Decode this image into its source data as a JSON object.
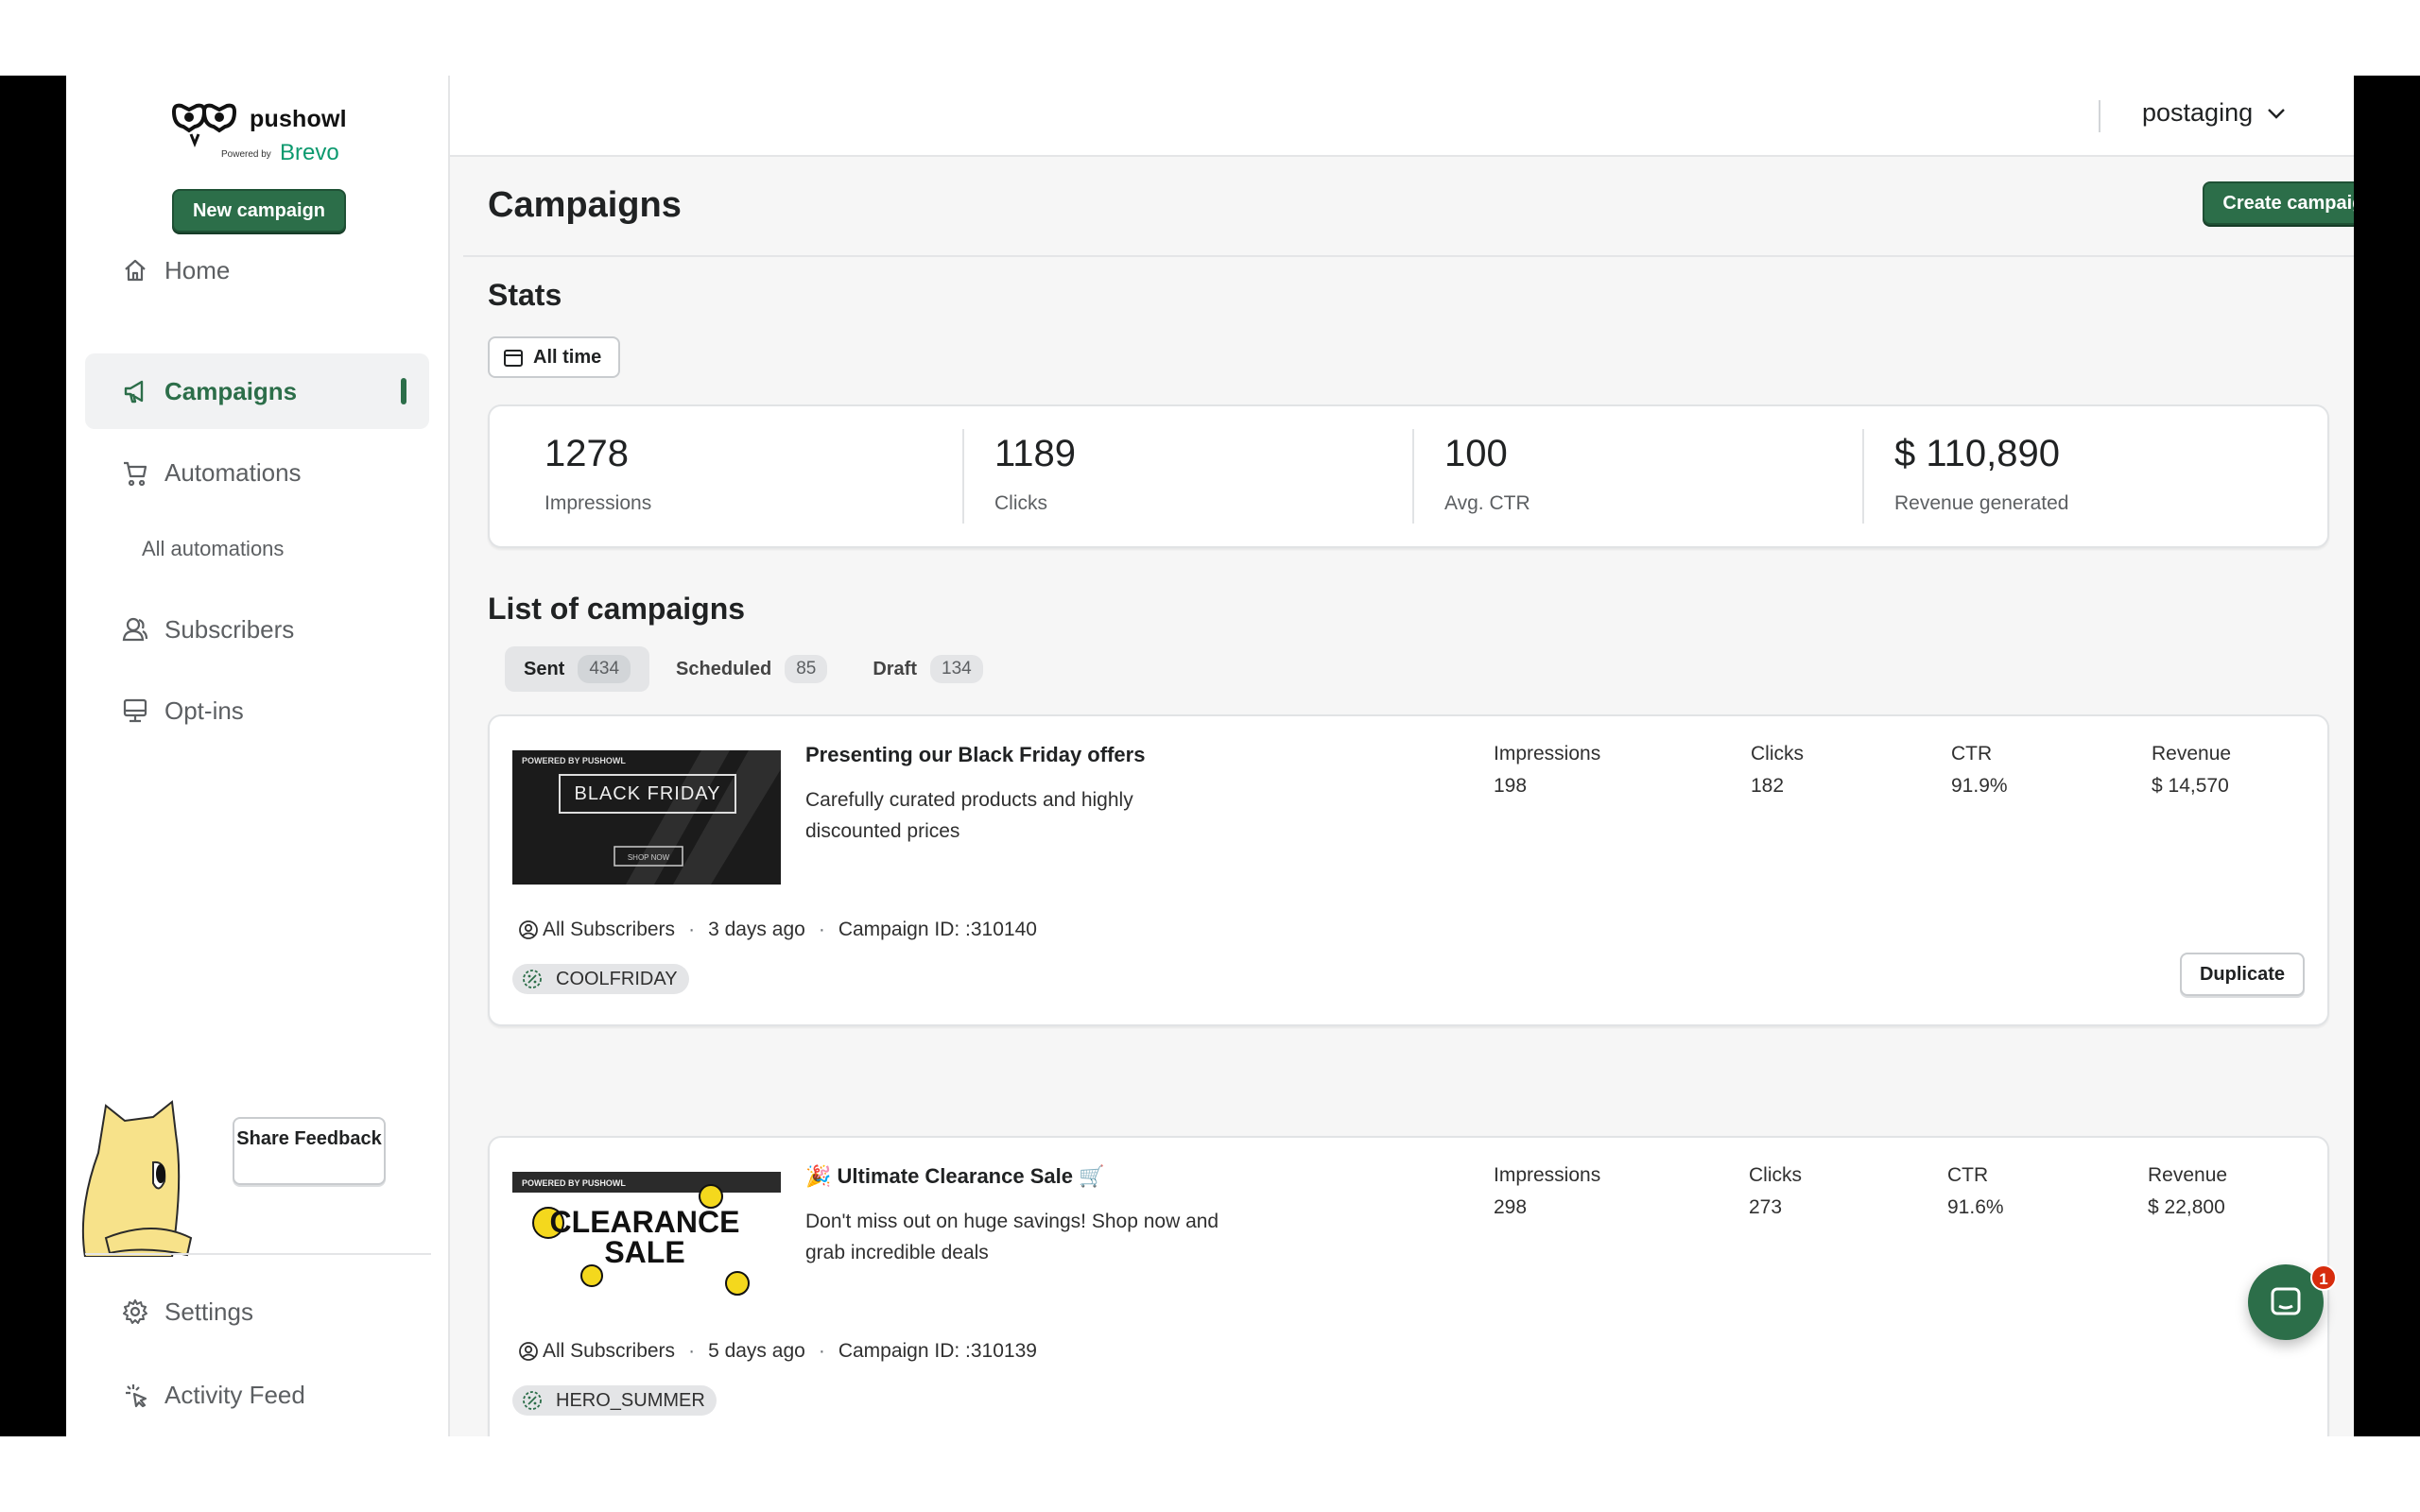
{
  "brand": {
    "name": "pushowl",
    "powered_by": "Powered by",
    "partner": "Brevo"
  },
  "sidebar": {
    "new_campaign_label": "New campaign",
    "items": [
      {
        "label": "Home",
        "icon": "home-icon"
      },
      {
        "label": "Campaigns",
        "icon": "megaphone-icon",
        "active": true
      },
      {
        "label": "Automations",
        "icon": "cart-icon"
      },
      {
        "label": "All automations",
        "sub": true
      },
      {
        "label": "Subscribers",
        "icon": "users-icon"
      },
      {
        "label": "Opt-ins",
        "icon": "monitor-icon"
      }
    ],
    "share_feedback": "Share Feedback",
    "bottom_items": [
      {
        "label": "Settings",
        "icon": "gear-icon"
      },
      {
        "label": "Activity Feed",
        "icon": "sparkle-icon"
      }
    ]
  },
  "topbar": {
    "store_name": "postaging"
  },
  "page": {
    "title": "Campaigns",
    "create_label": "Create campaign",
    "stats_title": "Stats",
    "time_filter": "All time",
    "stats": [
      {
        "value": "1278",
        "label": "Impressions"
      },
      {
        "value": "1189",
        "label": "Clicks"
      },
      {
        "value": "100",
        "label": "Avg. CTR"
      },
      {
        "value": "$ 110,890",
        "label": "Revenue generated"
      }
    ],
    "list_title": "List of campaigns",
    "tabs": [
      {
        "label": "Sent",
        "count": "434",
        "active": true
      },
      {
        "label": "Scheduled",
        "count": "85"
      },
      {
        "label": "Draft",
        "count": "134"
      }
    ]
  },
  "campaigns": [
    {
      "title": "Presenting our Black Friday offers",
      "description": "Carefully curated products and highly discounted prices",
      "thumb_top": "POWERED BY PUSHOWL",
      "thumb_main": "BLACK FRIDAY",
      "thumb_cta": "SHOP NOW",
      "metrics": [
        {
          "label": "Impressions",
          "value": "198"
        },
        {
          "label": "Clicks",
          "value": "182"
        },
        {
          "label": "CTR",
          "value": "91.9%"
        },
        {
          "label": "Revenue",
          "value": "$ 14,570"
        }
      ],
      "audience": "All Subscribers",
      "sent_ago": "3 days ago",
      "campaign_id": "Campaign ID: :310140",
      "coupon": "COOLFRIDAY",
      "duplicate_label": "Duplicate"
    },
    {
      "title": "🎉 Ultimate Clearance Sale 🛒",
      "description": "Don't miss out on huge savings! Shop now and grab incredible deals",
      "thumb_top": "POWERED BY PUSHOWL",
      "thumb_main_1": "CLEARANCE",
      "thumb_main_2": "SALE",
      "metrics": [
        {
          "label": "Impressions",
          "value": "298"
        },
        {
          "label": "Clicks",
          "value": "273"
        },
        {
          "label": "CTR",
          "value": "91.6%"
        },
        {
          "label": "Revenue",
          "value": "$ 22,800"
        }
      ],
      "audience": "All Subscribers",
      "sent_ago": "5 days ago",
      "campaign_id": "Campaign ID: :310139",
      "coupon": "HERO_SUMMER"
    }
  ],
  "chat": {
    "badge_count": "1"
  },
  "colors": {
    "brand_green": "#2c6e49",
    "brevo_green": "#0b996e",
    "badge_red": "#d72c0d"
  }
}
